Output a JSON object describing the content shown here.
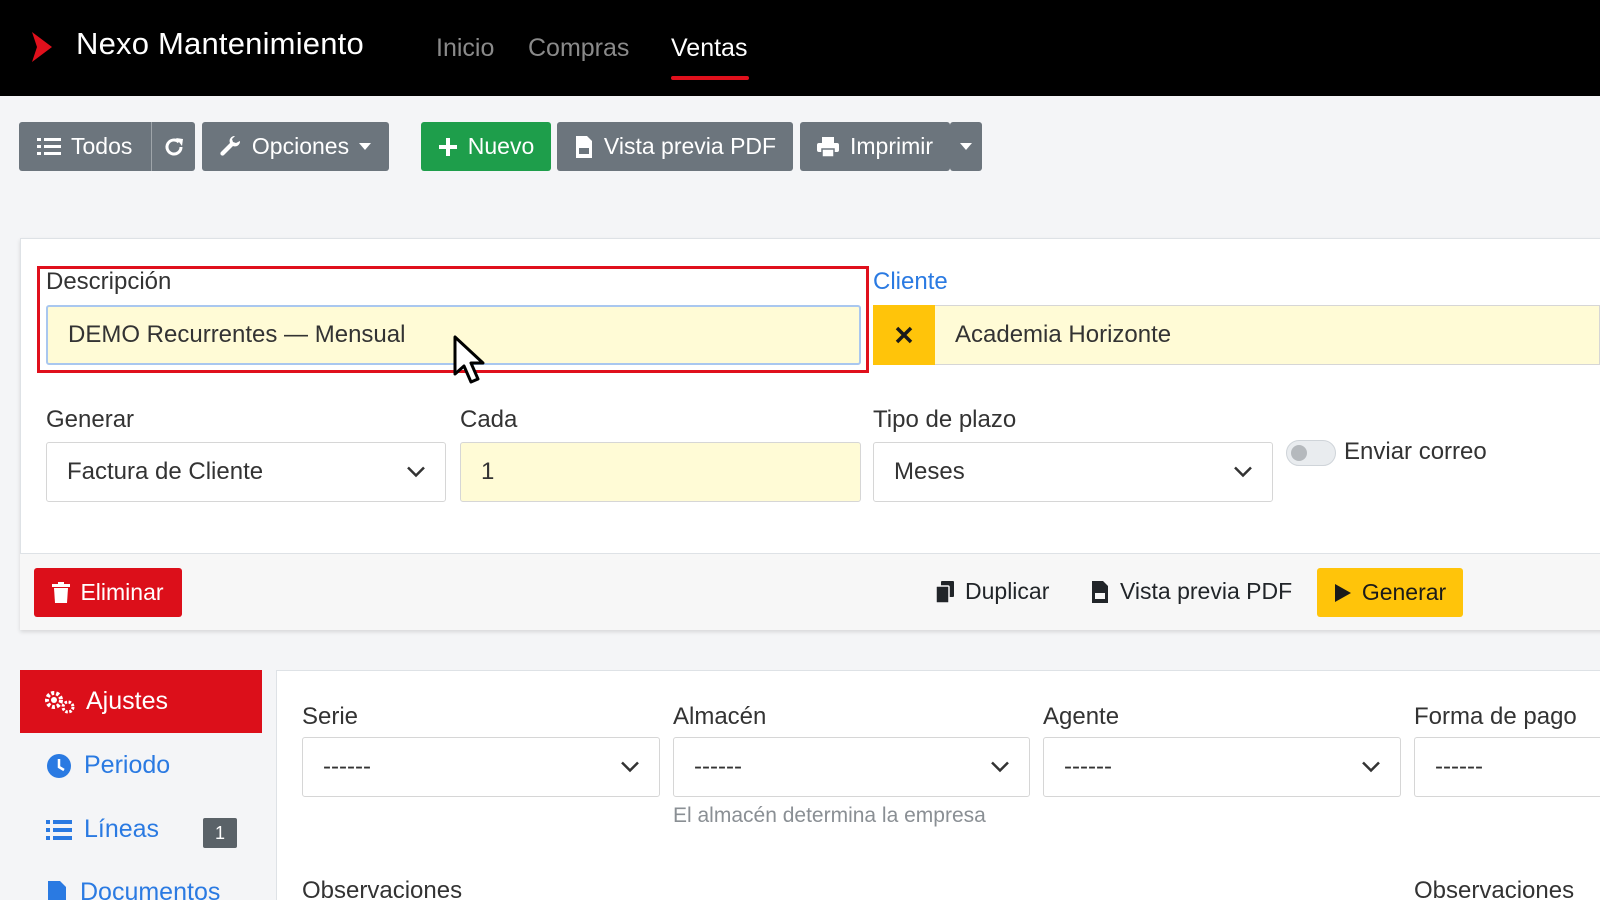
{
  "navbar": {
    "brand": "Nexo Mantenimiento",
    "items": [
      {
        "label": "Inicio",
        "active": false
      },
      {
        "label": "Compras",
        "active": false
      },
      {
        "label": "Ventas",
        "active": true
      }
    ]
  },
  "toolbar": {
    "all_label": "Todos",
    "options_label": "Opciones",
    "new_label": "Nuevo",
    "pdf_preview_label": "Vista previa PDF",
    "print_label": "Imprimir"
  },
  "form": {
    "description": {
      "label": "Descripción",
      "value": "DEMO Recurrentes — Mensual"
    },
    "client": {
      "label": "Cliente",
      "value": "Academia Horizonte"
    },
    "generate": {
      "label": "Generar",
      "value": "Factura de Cliente"
    },
    "every": {
      "label": "Cada",
      "value": "1"
    },
    "term_type": {
      "label": "Tipo de plazo",
      "value": "Meses"
    },
    "send_email": {
      "label": "Enviar correo",
      "checked": false
    }
  },
  "footer": {
    "delete_label": "Eliminar",
    "duplicate_label": "Duplicar",
    "pdf_preview_label": "Vista previa PDF",
    "generate_label": "Generar"
  },
  "sidebar": {
    "items": [
      {
        "label": "Ajustes",
        "active": true
      },
      {
        "label": "Periodo"
      },
      {
        "label": "Líneas",
        "badge": "1"
      },
      {
        "label": "Documentos"
      }
    ]
  },
  "settings": {
    "series": {
      "label": "Serie",
      "value": "------"
    },
    "warehouse": {
      "label": "Almacén",
      "value": "------",
      "help": "El almacén determina la empresa"
    },
    "agent": {
      "label": "Agente",
      "value": "------"
    },
    "payment": {
      "label": "Forma de pago",
      "value": "------"
    },
    "notes_label": "Observaciones",
    "notes2_label": "Observaciones"
  },
  "colors": {
    "accent_red": "#dc0f1a",
    "accent_yellow": "#ffc40a",
    "accent_green": "#1e9e4b",
    "link_blue": "#2a7ae2"
  }
}
